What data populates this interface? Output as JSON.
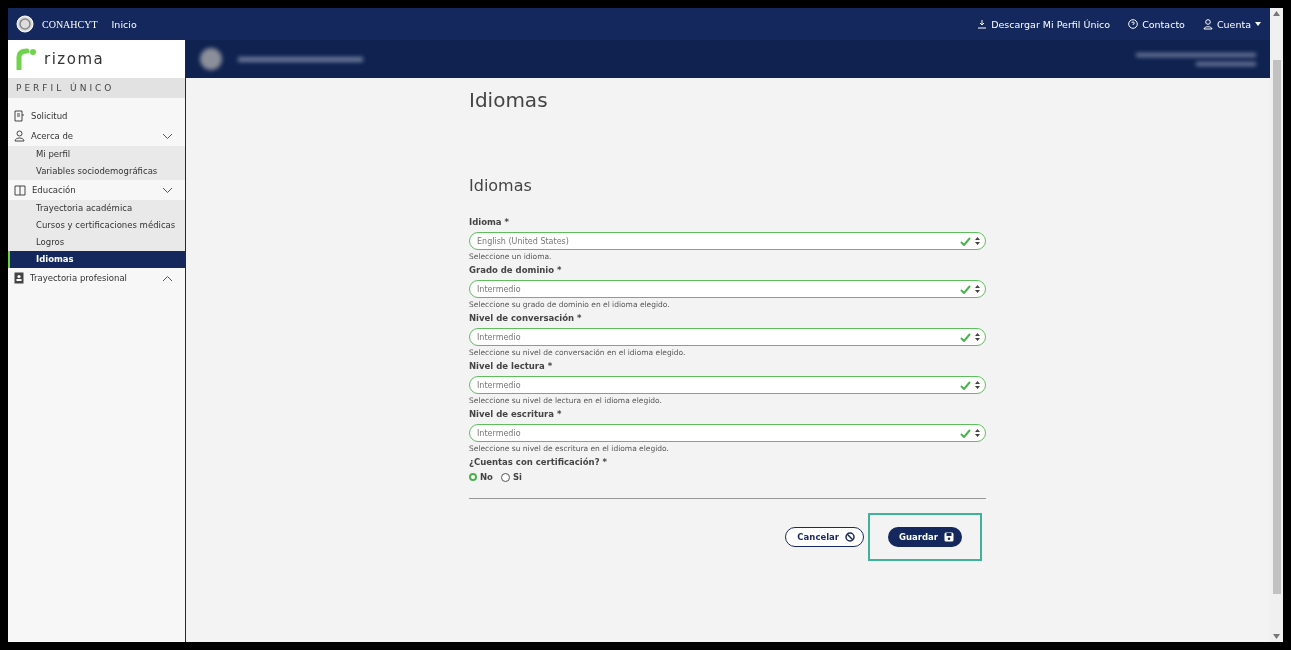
{
  "topbar": {
    "logo": "CONAHCYT",
    "home": "Inicio",
    "actions": [
      {
        "label": "Descargar Mi Perfil Único",
        "dropdown": false
      },
      {
        "label": "Contacto",
        "dropdown": false
      },
      {
        "label": "Cuenta",
        "dropdown": true
      }
    ]
  },
  "sidebar": {
    "brand": "rizoma",
    "section": "PERFIL ÚNICO",
    "items": [
      {
        "label": "Solicitud"
      },
      {
        "label": "Acerca de",
        "expanded": true,
        "children": [
          {
            "label": "Mi perfil",
            "selected": false
          },
          {
            "label": "Variables sociodemográficas",
            "selected": false
          }
        ]
      },
      {
        "label": "Educación",
        "expanded": true,
        "children": [
          {
            "label": "Trayectoria académica",
            "selected": false
          },
          {
            "label": "Cursos y certificaciones médicas",
            "selected": false
          },
          {
            "label": "Logros",
            "selected": false
          },
          {
            "label": "Idiomas",
            "selected": true
          }
        ]
      },
      {
        "label": "Trayectoria profesional",
        "expanded": false
      }
    ]
  },
  "form": {
    "page_title": "Idiomas",
    "section_title": "Idiomas",
    "fields": [
      {
        "label": "Idioma *",
        "value": "English (United States)",
        "hint": "Seleccione un idioma.",
        "valid": true
      },
      {
        "label": "Grado de dominio *",
        "value": "Intermedio",
        "hint": "Seleccione su grado de dominio en el idioma elegido.",
        "valid": true
      },
      {
        "label": "Nivel de conversación *",
        "value": "Intermedio",
        "hint": "Seleccione su nivel de conversación en el idioma elegido.",
        "valid": true
      },
      {
        "label": "Nivel de lectura *",
        "value": "Intermedio",
        "hint": "Seleccione su nivel de lectura en el idioma elegido.",
        "valid": true
      },
      {
        "label": "Nivel de escritura *",
        "value": "Intermedio",
        "hint": "Seleccione su nivel de escritura en el idioma elegido.",
        "valid": true
      }
    ],
    "certification": {
      "label": "¿Cuentas con certificación? *",
      "options": [
        {
          "label": "No",
          "selected": true
        },
        {
          "label": "Si",
          "selected": false
        }
      ]
    },
    "buttons": [
      {
        "kind": "cancel",
        "label": "Cancelar",
        "highlighted": false
      },
      {
        "kind": "save",
        "label": "Guardar",
        "highlighted": true
      }
    ]
  }
}
